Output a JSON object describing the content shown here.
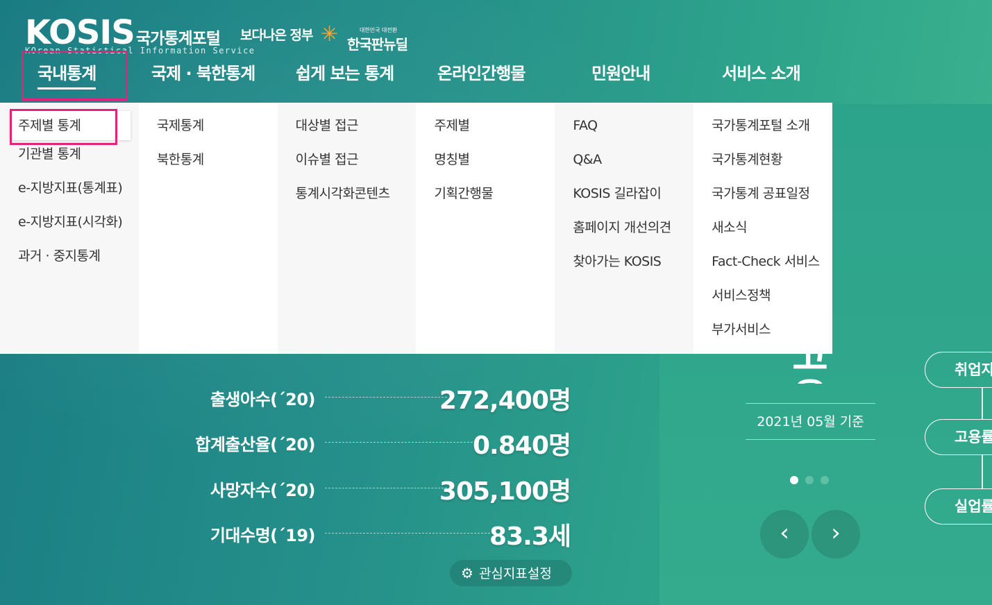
{
  "logo": {
    "main": "KOSIS",
    "korean": "국가통계포털",
    "sub": "KOrean Statistical Information Service"
  },
  "badges": {
    "gov": "보다나은 정부",
    "newdeal_small": "대한민국 대전환",
    "newdeal_big": "한국판뉴딜"
  },
  "gnb": [
    {
      "label": "국내통계"
    },
    {
      "label": "국제 · 북한통계"
    },
    {
      "label": "쉽게 보는 통계"
    },
    {
      "label": "온라인간행물"
    },
    {
      "label": "민원안내"
    },
    {
      "label": "서비스 소개"
    }
  ],
  "dropdown": [
    [
      "주제별 통계",
      "기관별 통계",
      "e-지방지표(통계표)",
      "e-지방지표(시각화)",
      "과거 · 중지통계"
    ],
    [
      "국제통계",
      "북한통계"
    ],
    [
      "대상별 접근",
      "이슈별 접근",
      "통계시각화콘텐츠"
    ],
    [
      "주제별",
      "명칭별",
      "기획간행물"
    ],
    [
      "FAQ",
      "Q&A",
      "KOSIS 길라잡이",
      "홈페이지 개선의견",
      "찾아가는 KOSIS"
    ],
    [
      "국가통계포털 소개",
      "국가통계현황",
      "국가통계 공표일정",
      "새소식",
      "Fact-Check 서비스",
      "서비스정책",
      "부가서비스"
    ]
  ],
  "stats": [
    {
      "label": "출생아수(´20)",
      "value": "272,400명"
    },
    {
      "label": "합계출산율(´20)",
      "value": "0.840명"
    },
    {
      "label": "사망자수(´20)",
      "value": "305,100명"
    },
    {
      "label": "기대수명(´19)",
      "value": "83.3세"
    }
  ],
  "setting_button": "관심지표설정",
  "indicator": {
    "title": "고용",
    "date": "2021년 05월 기준",
    "pills": [
      "취업자",
      "고용률",
      "실업률"
    ]
  },
  "colors": {
    "highlight": "#e0247c",
    "dot_active": "#ffffff",
    "dot_inactive": "#5fc0a4"
  },
  "icons": {
    "prev": "‹",
    "next": "›",
    "gear": "⚙"
  }
}
